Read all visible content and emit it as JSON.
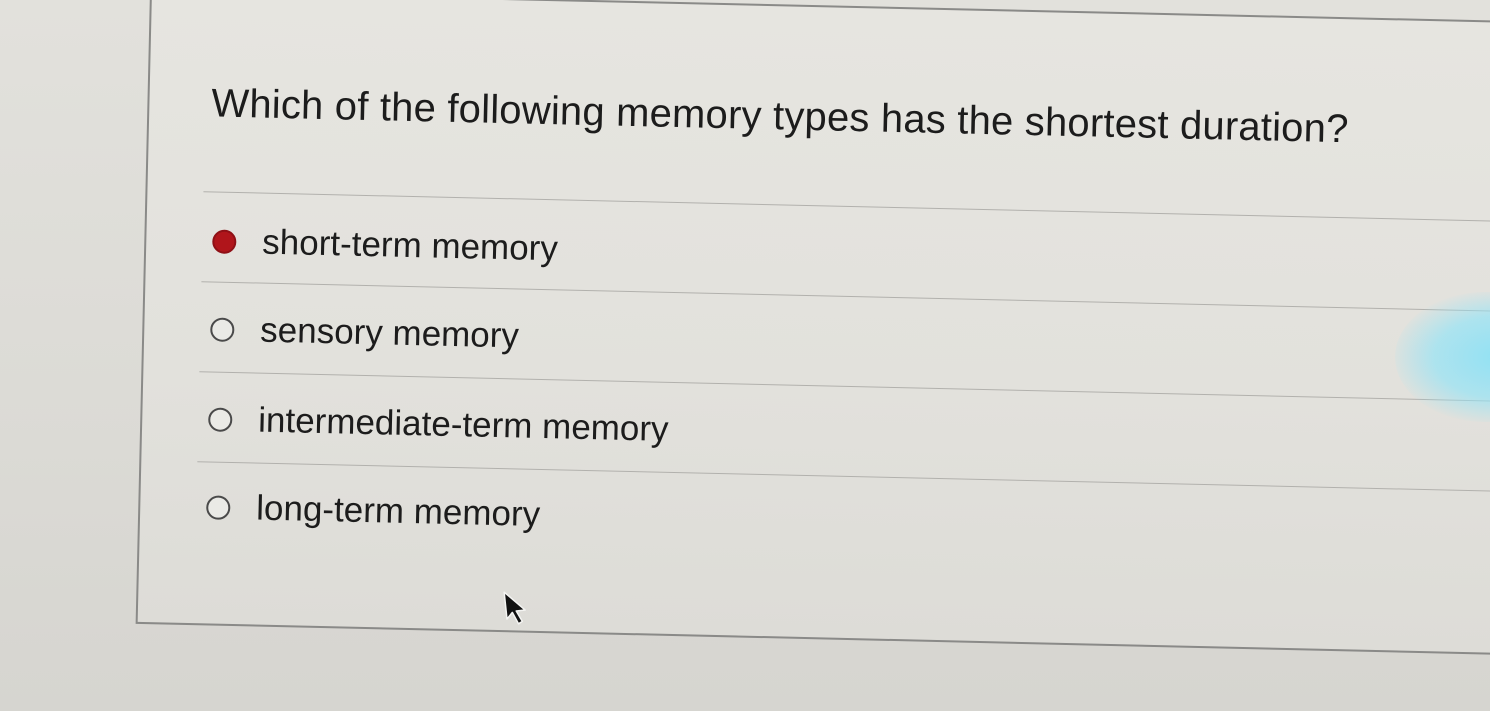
{
  "question": {
    "text": "Which of the following memory types has the shortest duration?"
  },
  "options": [
    {
      "label": "short-term memory",
      "selected": true
    },
    {
      "label": "sensory memory",
      "selected": false
    },
    {
      "label": "intermediate-term memory",
      "selected": false
    },
    {
      "label": "long-term memory",
      "selected": false
    }
  ],
  "colors": {
    "selected_radio": "#b0151b",
    "text": "#1c1c1c",
    "background": "#dcdbd6"
  },
  "icons": {
    "pointer": "mouse-pointer-icon"
  }
}
